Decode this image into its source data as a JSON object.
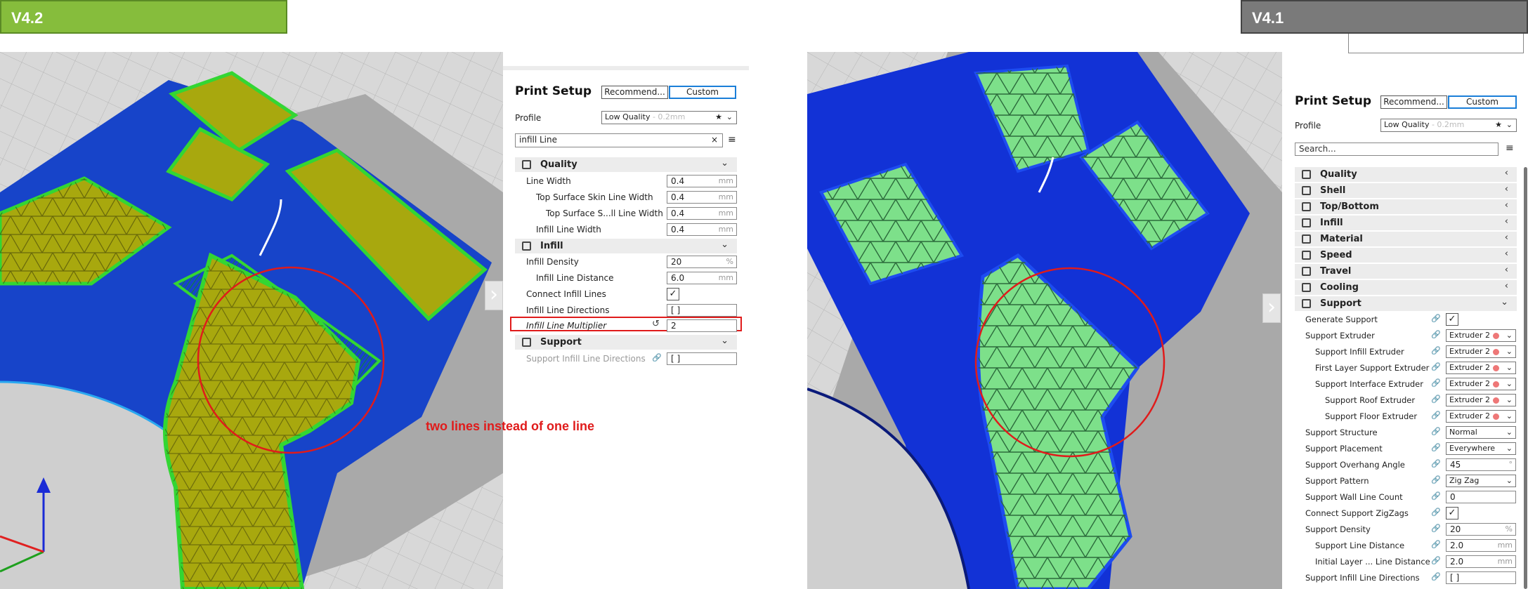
{
  "badges": {
    "left": "V4.2",
    "right": "V4.1"
  },
  "annotation": "two lines instead of one line",
  "left_panel": {
    "title": "Print Setup",
    "recommended_label": "Recommend...",
    "custom_label": "Custom",
    "profile_label": "Profile",
    "profile_value": "Low Quality",
    "profile_sub": "- 0.2mm",
    "search_value": "infill Line",
    "categories": {
      "quality": "Quality",
      "infill": "Infill",
      "support": "Support"
    },
    "settings": {
      "line_width": {
        "label": "Line Width",
        "value": "0.4",
        "unit": "mm"
      },
      "top_skin_lw": {
        "label": "Top Surface Skin Line Width",
        "value": "0.4",
        "unit": "mm"
      },
      "top_s_lw": {
        "label": "Top Surface S...ll Line Width",
        "value": "0.4",
        "unit": "mm"
      },
      "infill_lw": {
        "label": "Infill Line Width",
        "value": "0.4",
        "unit": "mm"
      },
      "infill_density": {
        "label": "Infill Density",
        "value": "20",
        "unit": "%"
      },
      "infill_ld": {
        "label": "Infill Line Distance",
        "value": "6.0",
        "unit": "mm"
      },
      "connect_infill": {
        "label": "Connect Infill Lines"
      },
      "infill_dirs": {
        "label": "Infill Line Directions",
        "value": "[ ]"
      },
      "infill_mult": {
        "label": "Infill Line Multiplier",
        "value": "2"
      },
      "support_dirs": {
        "label": "Support Infill Line Directions",
        "value": "[ ]"
      }
    }
  },
  "right_panel": {
    "title": "Print Setup",
    "recommended_label": "Recommend...",
    "custom_label": "Custom",
    "profile_label": "Profile",
    "profile_value": "Low Quality",
    "profile_sub": "- 0.2mm",
    "search_placeholder": "Search...",
    "categories": [
      "Quality",
      "Shell",
      "Top/Bottom",
      "Infill",
      "Material",
      "Speed",
      "Travel",
      "Cooling",
      "Support"
    ],
    "settings": [
      {
        "label": "Generate Support",
        "type": "check",
        "indent": 0
      },
      {
        "label": "Support Extruder",
        "type": "extruder",
        "value": "Extruder 2",
        "indent": 0
      },
      {
        "label": "Support Infill Extruder",
        "type": "extruder",
        "value": "Extruder 2",
        "indent": 1
      },
      {
        "label": "First Layer Support Extruder",
        "type": "extruder",
        "value": "Extruder 2",
        "indent": 1
      },
      {
        "label": "Support Interface Extruder",
        "type": "extruder",
        "value": "Extruder 2",
        "indent": 1
      },
      {
        "label": "Support Roof Extruder",
        "type": "extruder",
        "value": "Extruder 2",
        "indent": 2
      },
      {
        "label": "Support Floor Extruder",
        "type": "extruder",
        "value": "Extruder 2",
        "indent": 2
      },
      {
        "label": "Support Structure",
        "type": "select",
        "value": "Normal",
        "indent": 0
      },
      {
        "label": "Support Placement",
        "type": "select",
        "value": "Everywhere",
        "indent": 0
      },
      {
        "label": "Support Overhang Angle",
        "type": "text",
        "value": "45",
        "unit": "°",
        "indent": 0
      },
      {
        "label": "Support Pattern",
        "type": "select",
        "value": "Zig Zag",
        "indent": 0
      },
      {
        "label": "Support Wall Line Count",
        "type": "text",
        "value": "0",
        "indent": 0
      },
      {
        "label": "Connect Support ZigZags",
        "type": "check",
        "indent": 0
      },
      {
        "label": "Support Density",
        "type": "text",
        "value": "20",
        "unit": "%",
        "indent": 0
      },
      {
        "label": "Support Line Distance",
        "type": "text",
        "value": "2.0",
        "unit": "mm",
        "indent": 1
      },
      {
        "label": "Initial Layer ... Line Distance",
        "type": "text",
        "value": "2.0",
        "unit": "mm",
        "indent": 1
      },
      {
        "label": "Support Infill Line Directions",
        "type": "text",
        "value": "[ ]",
        "indent": 0
      }
    ]
  }
}
